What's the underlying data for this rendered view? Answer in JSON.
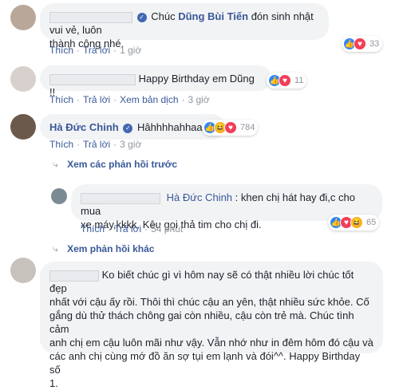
{
  "comments": [
    {
      "text": "Chúc Dũng Bùi Tiến đón sinh nhật vui vẻ, luôn thành công nhé.",
      "text_line1_pre": "Chúc ",
      "mention": "Dũng Bùi Tiến",
      "text_line1_post": " đón sinh nhật vui vẻ, luôn",
      "text_line2": "thành công nhé.",
      "like": "Thích",
      "reply": "Trả lời",
      "time": "1 giờ",
      "reactions": "33"
    },
    {
      "text": "Happy Birthday em Dũng !!",
      "like": "Thích",
      "reply": "Trả lời",
      "translate": "Xem bản dịch",
      "time": "3 giờ",
      "reactions": "11"
    },
    {
      "author": "Hà Đức Chinh",
      "text": "Hâhhhhahhaah",
      "like": "Thích",
      "reply": "Trả lời",
      "time": "3 giờ",
      "reactions": "784",
      "prev_replies": "Xem các phản hồi trước"
    },
    {
      "mention": "Hà Đức Chinh",
      "text_line1": ": khen chị hát hay đi,c cho mua",
      "text_line2": "xe máy,kkkk. Kêu gọi thả tim cho chị đi.",
      "like": "Thích",
      "reply": "Trả lời",
      "time": "54 phút",
      "reactions": "65",
      "other_replies": "Xem phản hồi khác"
    },
    {
      "lines": [
        "Ko biết chúc gì vì hôm nay sẽ có thật nhiều lời chúc tốt đẹp",
        "nhất với cậu ấy rồi. Thôi thì chúc cậu an yên, thật nhiều sức khỏe. Cố",
        "gắng dù thử thách chông gai còn nhiều, cậu còn trẻ mà. Chúc tình cảm",
        "anh chị em cậu luôn mãi như vậy. Vẫn nhớ như in đêm hôm đó cậu và",
        "các anh chị cùng mớ đồ ăn sợ tụi em lạnh và đói^^. Happy Birthday số",
        "1."
      ]
    }
  ],
  "colors": {
    "link": "#385898",
    "bubble": "#f2f3f5",
    "meta": "#90949c"
  }
}
